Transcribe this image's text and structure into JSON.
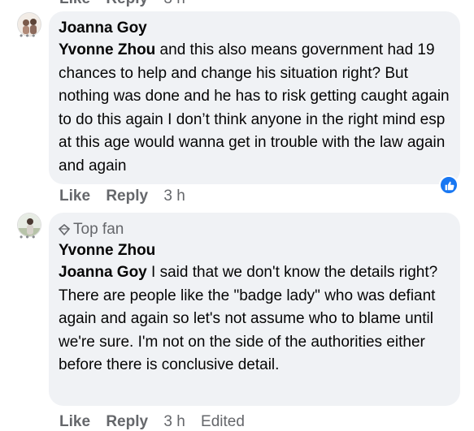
{
  "top_cutoff": {
    "like": "Like",
    "reply": "Reply",
    "time": "3 h"
  },
  "comment1": {
    "author": "Joanna Goy",
    "mention": "Yvonne Zhou",
    "text": " and this also means government had 19 chances to help and change his situation right? But nothing was done and he has to risk getting caught again to do this again I don’t think anyone in the right mind esp at this age would wanna get in trouble with the law again and again",
    "actions": {
      "like": "Like",
      "reply": "Reply",
      "time": "3 h"
    },
    "reaction": "like-icon"
  },
  "comment2": {
    "badge": "Top fan",
    "author": "Yvonne Zhou",
    "mention": "Joanna Goy",
    "text": " I said that we don't know the details right? There are people like the \"badge lady\" who was defiant again and again so let's not assume who to blame until we're sure. I'm not on the side of the authorities either before there is conclusive detail."
  },
  "bottom_cutoff": {
    "like": "Like",
    "reply": "Reply",
    "time": "3 h",
    "edited": "Edited"
  },
  "colors": {
    "bubble": "#f0f2f5",
    "secondary_text": "#65676b",
    "like_blue": "#1877f2"
  }
}
